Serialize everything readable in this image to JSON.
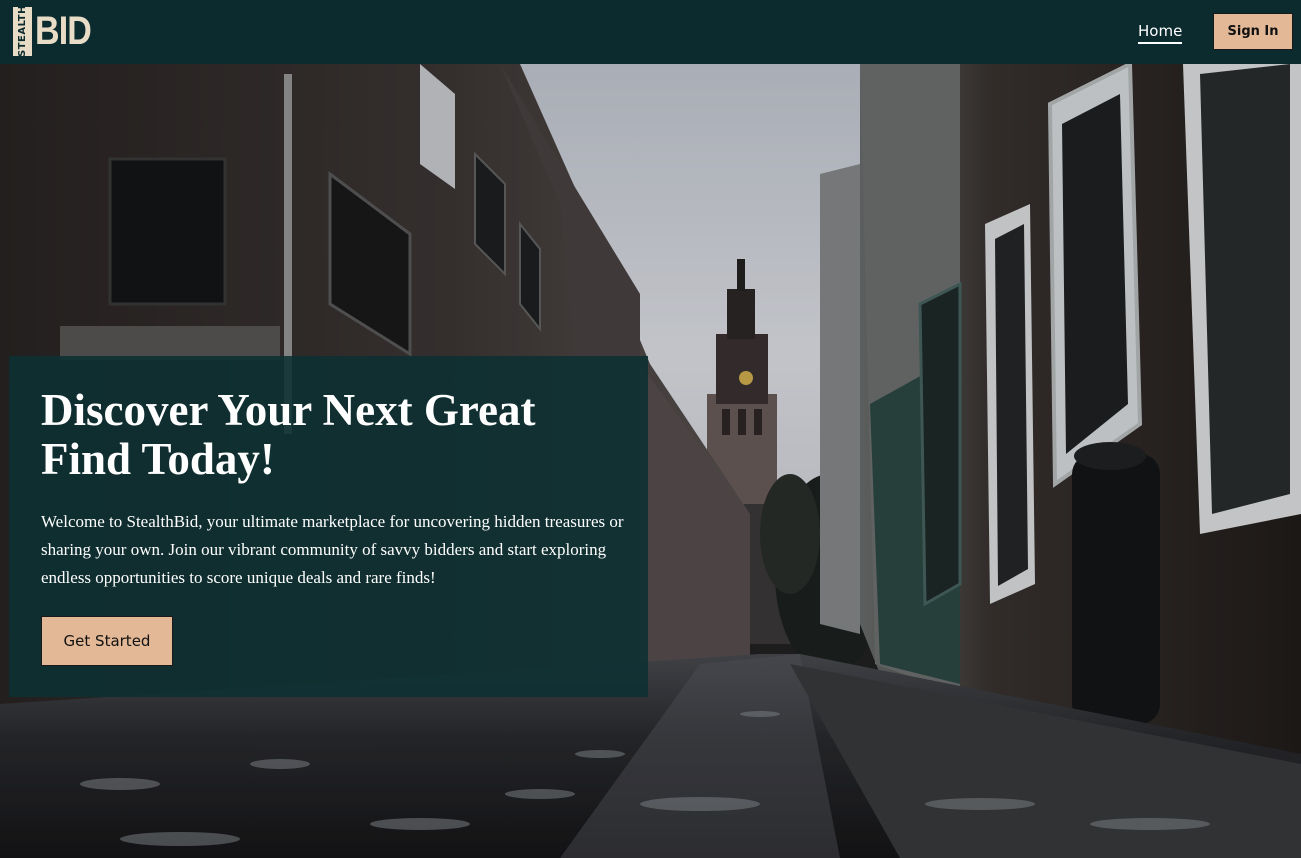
{
  "brand": {
    "logo_stealth": "STEALTH",
    "logo_bid": "BID"
  },
  "nav": {
    "home_label": "Home",
    "signin_label": "Sign In"
  },
  "hero": {
    "title": "Discover Your Next Great Find Today!",
    "description": "Welcome to StealthBid, your ultimate marketplace for uncovering hidden treasures or sharing your own. Join our vibrant community of savvy bidders and start exploring endless opportunities to score unique deals and rare finds!",
    "cta_label": "Get Started",
    "background_image": "wet-cobblestone-alley-with-church-tower-icon"
  },
  "colors": {
    "navbar_bg": "#0c2b2f",
    "accent": "#e3b896",
    "panel_bg": "#0c3032",
    "logo_color": "#e9dcc6"
  }
}
